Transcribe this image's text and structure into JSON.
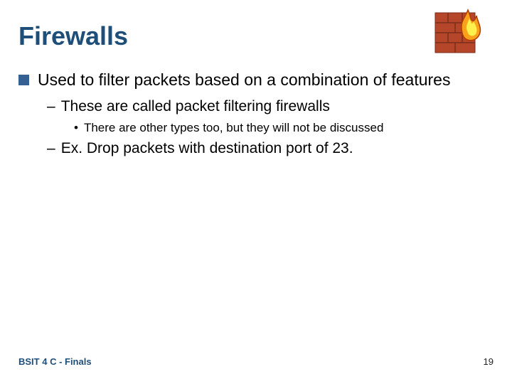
{
  "title": "Firewalls",
  "bullets": {
    "main": "Used to filter packets based on a combination of features",
    "sub1": "These are called packet filtering firewalls",
    "sub1a": "There are other types too, but they will not be discussed",
    "sub2": "Ex. Drop packets with destination port of 23."
  },
  "footer": "BSIT 4 C - Finals",
  "page": "19",
  "icon": {
    "name": "firewall-icon"
  }
}
